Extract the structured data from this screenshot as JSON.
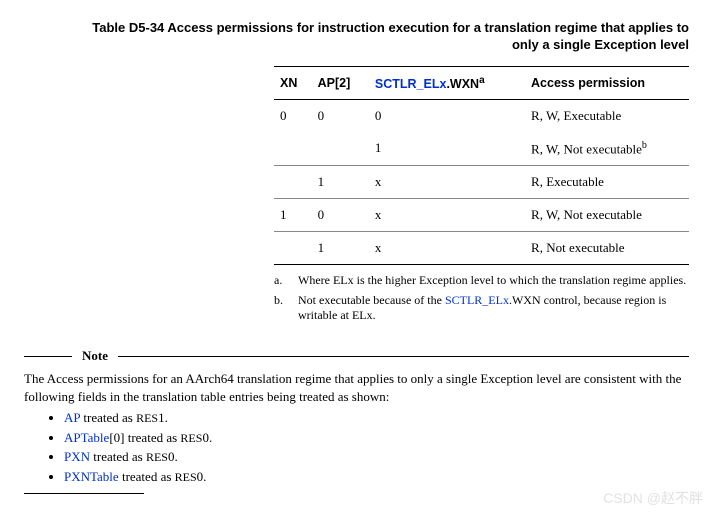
{
  "title_line1": "Table D5-34 Access permissions for instruction execution for a translation regime that applies to",
  "title_line2": "only a single Exception level",
  "headers": {
    "xn": "XN",
    "ap2": "AP[2]",
    "sctlr_link": "SCTLR_ELx",
    "sctlr_suffix": ".WXN",
    "sctlr_footref": "a",
    "access": "Access permission"
  },
  "rows": [
    {
      "xn": "0",
      "ap2": "0",
      "wxn": "0",
      "perm": "R, W, Executable",
      "sep": false,
      "fref": ""
    },
    {
      "xn": "",
      "ap2": "",
      "wxn": "1",
      "perm": "R, W, Not executable",
      "sep": true,
      "fref": "b"
    },
    {
      "xn": "",
      "ap2": "1",
      "wxn": "x",
      "perm": "R, Executable",
      "sep": true,
      "fref": ""
    },
    {
      "xn": "1",
      "ap2": "0",
      "wxn": "x",
      "perm": "R, W, Not executable",
      "sep": true,
      "fref": ""
    },
    {
      "xn": "",
      "ap2": "1",
      "wxn": "x",
      "perm": "R, Not executable",
      "sep": false,
      "fref": ""
    }
  ],
  "footnotes": {
    "a_marker": "a.",
    "a_text": "Where ELx is the higher Exception level to which the translation regime applies.",
    "b_marker": "b.",
    "b_pre": "Not executable because of the ",
    "b_link": "SCTLR_ELx",
    "b_post": ".WXN control, because region is writable at ELx."
  },
  "note": {
    "label": "Note",
    "para": "The Access permissions for an AArch64 translation regime that applies to only a single Exception level are consistent with the following fields in the translation table entries being treated as shown:",
    "bullets": [
      {
        "link": "AP",
        "rest": " treated as ",
        "res": "RES",
        "after": "1."
      },
      {
        "link": "APTable",
        "rest": "[0] treated as ",
        "res": "RES",
        "after": "0."
      },
      {
        "link": "PXN",
        "rest": " treated as ",
        "res": "RES",
        "after": "0."
      },
      {
        "link": "PXNTable",
        "rest": " treated as ",
        "res": "RES",
        "after": "0."
      }
    ]
  },
  "watermark": "CSDN @赵不胖"
}
